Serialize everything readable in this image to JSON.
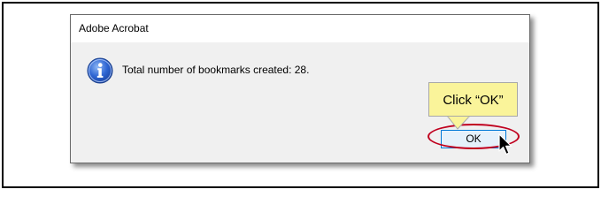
{
  "dialog": {
    "title": "Adobe Acrobat",
    "message": "Total number of bookmarks created: 28.",
    "icon": "info-icon",
    "ok_label": "OK"
  },
  "annotation": {
    "callout_text": "Click “OK”",
    "callout_color": "#faf49a",
    "highlight_color": "#c0001e"
  }
}
